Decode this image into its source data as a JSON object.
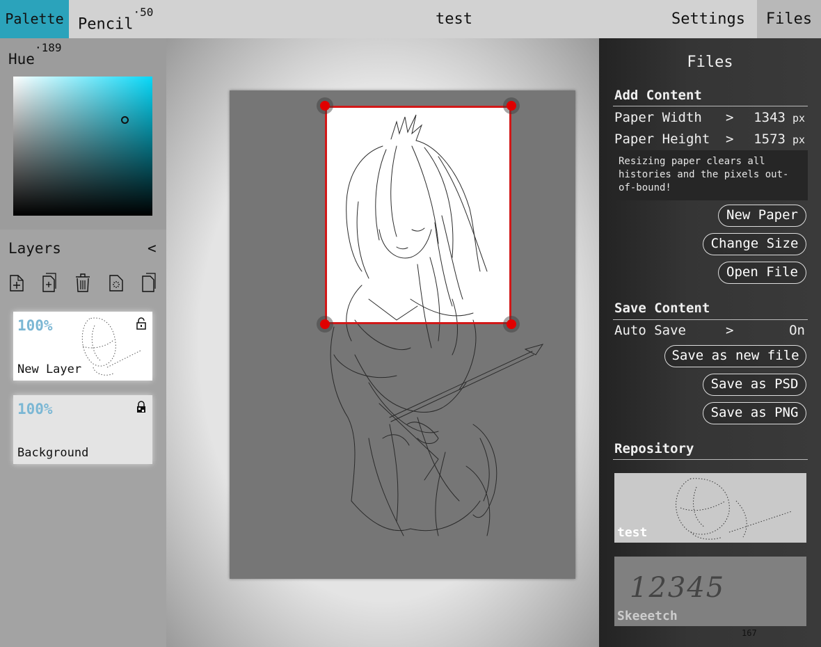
{
  "topbar": {
    "palette": "Palette",
    "tool": "Pencil",
    "tool_size": "50",
    "title": "test",
    "settings": "Settings",
    "files": "Files"
  },
  "palette": {
    "hue_label": "Hue",
    "hue_value": "189",
    "color": "#08d8f8"
  },
  "layers": {
    "title": "Layers",
    "collapse": "<",
    "tools": [
      "add-layer-icon",
      "duplicate-layer-icon",
      "delete-layer-icon",
      "clear-layer-icon",
      "merge-layer-icon"
    ],
    "items": [
      {
        "opacity": "100%",
        "name": "New Layer",
        "lock": "unlocked"
      },
      {
        "opacity": "100%",
        "name": "Background",
        "lock": "locked"
      }
    ]
  },
  "files_panel": {
    "title": "Files",
    "add_content": {
      "title": "Add Content",
      "paper_width_label": "Paper Width",
      "paper_width_arrow": ">",
      "paper_width_value": "1343",
      "paper_width_unit": "px",
      "paper_height_label": "Paper Height",
      "paper_height_arrow": ">",
      "paper_height_value": "1573",
      "paper_height_unit": "px",
      "warning": "Resizing paper clears all histories and the pixels out-of-bound!",
      "new_paper": "New Paper",
      "change_size": "Change Size",
      "open_file": "Open File"
    },
    "save_content": {
      "title": "Save Content",
      "auto_save_label": "Auto Save",
      "auto_save_arrow": ">",
      "auto_save_value": "On",
      "save_new": "Save as new file",
      "save_psd": "Save as PSD",
      "save_png": "Save as PNG"
    },
    "repository": {
      "title": "Repository",
      "items": [
        {
          "name": "test"
        },
        {
          "name": "Skeeetch",
          "preview_text": "12345"
        }
      ]
    },
    "footer_number": "167"
  },
  "colors": {
    "accent": "#2ba3bb",
    "selection": "#d21818",
    "layer_opacity": "#7bb7d4"
  }
}
